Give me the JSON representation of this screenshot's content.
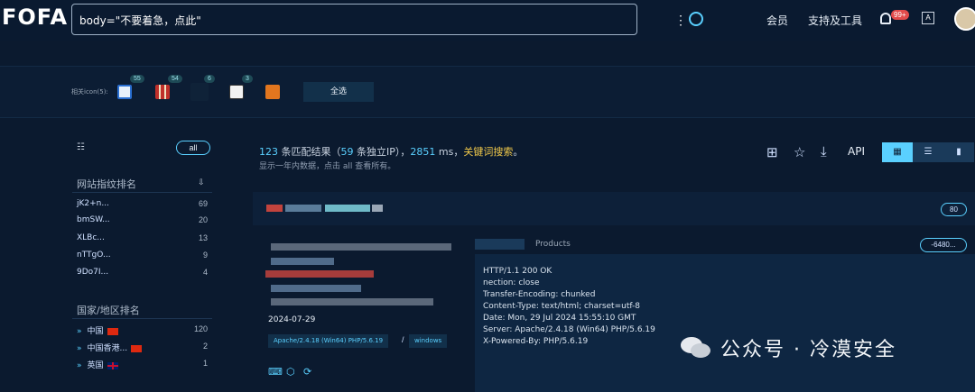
{
  "header": {
    "logo": "FOFA",
    "search_value": "body=\"不要着急，点此\"",
    "member": "会员",
    "support": "支持及工具",
    "notif_badge": "99+"
  },
  "icon_strip": {
    "label": "相关icon(5):",
    "icons": [
      {
        "name": "ie-icon",
        "count": "55"
      },
      {
        "name": "red-grid-icon",
        "count": "54"
      },
      {
        "name": "blank-icon",
        "count": "6"
      },
      {
        "name": "building-icon",
        "count": "3"
      },
      {
        "name": "r-logo-icon",
        "count": ""
      }
    ],
    "select_all": "全选"
  },
  "sidebar": {
    "all": "all",
    "fingerprint_title": "网站指纹排名",
    "fingerprints": [
      {
        "name": "jK2+n...",
        "count": "69"
      },
      {
        "name": "bmSW...",
        "count": "20"
      },
      {
        "name": "XLBc...",
        "count": "13"
      },
      {
        "name": "nTTgO...",
        "count": "9"
      },
      {
        "name": "9Do7I...",
        "count": "4"
      }
    ],
    "country_title": "国家/地区排名",
    "countries": [
      {
        "name": "中国",
        "count": "120"
      },
      {
        "name": "中国香港...",
        "count": "2"
      },
      {
        "name": "英国",
        "count": "1"
      }
    ]
  },
  "results": {
    "count": "123",
    "count_suffix": " 条匹配结果（",
    "ip_count": "59",
    "ip_suffix": " 条独立IP），",
    "ms": "2851",
    "ms_suffix": " ms，",
    "keyword": "关键词搜索",
    "end": "。",
    "subtext": "显示一年内数据，点击 all 查看所有。",
    "api": "API"
  },
  "card": {
    "port": "80",
    "date": "2024-07-29",
    "tag1": "Apache/2.4.18 (Win64) PHP/5.6.19",
    "slash": "/",
    "tag2": "windows",
    "tab_products": "Products",
    "hash": "-6480...",
    "headers": [
      "HTTP/1.1 200 OK",
      "  nection: close",
      "Transfer-Encoding: chunked",
      "Content-Type: text/html; charset=utf-8",
      "Date: Mon, 29 Jul 2024 15:55:10 GMT",
      "Server: Apache/2.4.18 (Win64) PHP/5.6.19",
      "X-Powered-By: PHP/5.6.19"
    ]
  },
  "watermark": "公众号 · 冷漠安全"
}
